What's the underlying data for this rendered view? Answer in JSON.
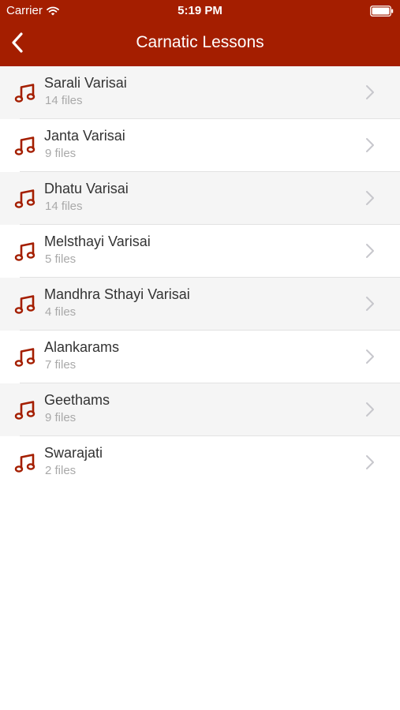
{
  "status_bar": {
    "carrier": "Carrier",
    "time": "5:19 PM",
    "icons": [
      "wifi-icon",
      "battery-icon"
    ]
  },
  "navbar": {
    "title": "Carnatic Lessons",
    "back_icon": "chevron-left-icon"
  },
  "colors": {
    "brand": "#a41e00",
    "row_alt": "#f5f5f5",
    "title_text": "#333333",
    "subtitle_text": "#a9a9a9",
    "chevron": "#c7c7cc"
  },
  "lessons": [
    {
      "title": "Sarali Varisai",
      "subtitle": "14 files",
      "icon": "music-note-icon"
    },
    {
      "title": "Janta Varisai",
      "subtitle": "9 files",
      "icon": "music-note-icon"
    },
    {
      "title": "Dhatu Varisai",
      "subtitle": "14 files",
      "icon": "music-note-icon"
    },
    {
      "title": "Melsthayi Varisai",
      "subtitle": "5 files",
      "icon": "music-note-icon"
    },
    {
      "title": "Mandhra Sthayi Varisai",
      "subtitle": "4 files",
      "icon": "music-note-icon"
    },
    {
      "title": "Alankarams",
      "subtitle": "7 files",
      "icon": "music-note-icon"
    },
    {
      "title": "Geethams",
      "subtitle": "9 files",
      "icon": "music-note-icon"
    },
    {
      "title": "Swarajati",
      "subtitle": "2 files",
      "icon": "music-note-icon"
    }
  ]
}
